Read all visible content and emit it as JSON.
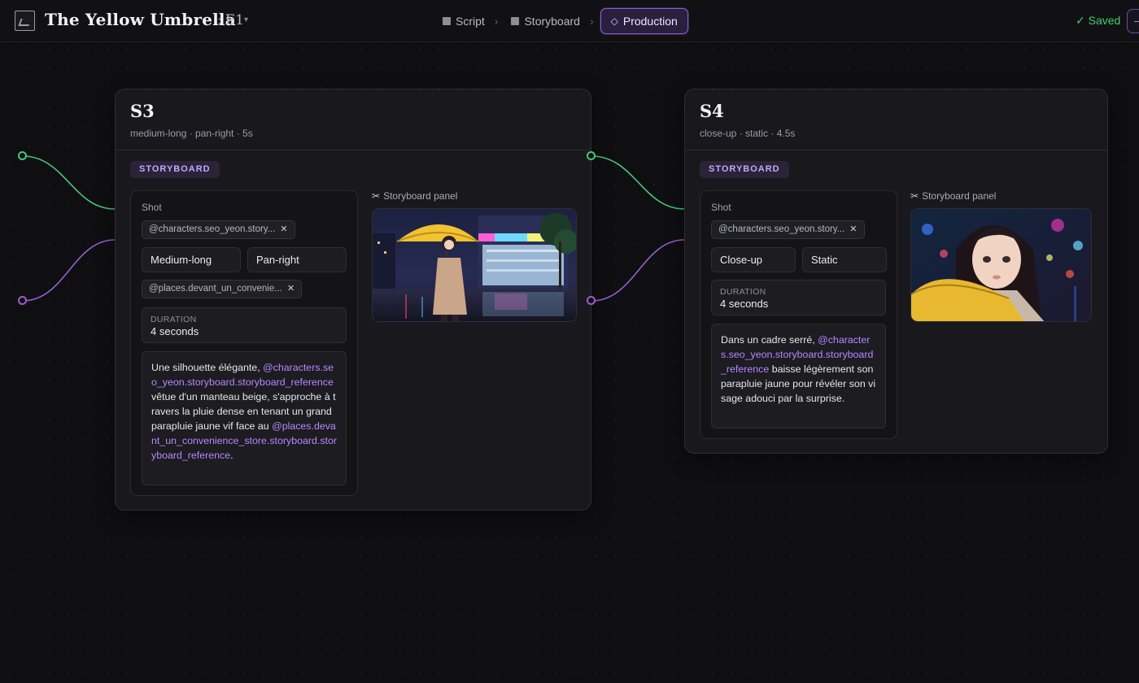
{
  "app": {
    "title": "The Yellow Umbrella",
    "episode_sep": ":",
    "episode": "E1",
    "saved": "✓ Saved"
  },
  "nav": {
    "items": [
      {
        "label": "Script",
        "icon": "square-icon"
      },
      {
        "label": "Storyboard",
        "icon": "square-icon"
      },
      {
        "label": "Production",
        "icon": "diamond-icon",
        "active": true
      }
    ],
    "separator": "›",
    "active_diamond": "◇"
  },
  "nodes": [
    {
      "title": "S3",
      "subtitle": "medium-long · pan-right · 5s",
      "badge": "STORYBOARD",
      "shot_label": "Shot",
      "character_chip": "@characters.seo_yeon.story...",
      "framing": "Medium-long",
      "movement": "Pan-right",
      "place_chip": "@places.devant_un_convenie...",
      "duration_label": "DURATION",
      "duration_value": "4 seconds",
      "desc_1": "Une silhouette élégante, ",
      "desc_ref_1": "@characters.seo_yeon.storyboard.storyboard_reference",
      "desc_2": " vêtue d'un manteau beige, s'approche à travers la pluie dense en tenant un grand parapluie jaune vif face au ",
      "desc_ref_2": "@places.devant_un_convenience_store.storyboard.storyboard_reference",
      "desc_3": ".",
      "panel_label": "Storyboard panel"
    },
    {
      "title": "S4",
      "subtitle": "close-up · static · 4.5s",
      "badge": "STORYBOARD",
      "shot_label": "Shot",
      "character_chip": "@characters.seo_yeon.story...",
      "framing": "Close-up",
      "movement": "Static",
      "duration_label": "DURATION",
      "duration_value": "4 seconds",
      "desc_1": "Dans un cadre serré, ",
      "desc_ref_1": "@characters.seo_yeon.storyboard.storyboard_reference",
      "desc_2": " baisse légèrement son parapluie jaune pour révéler son visage adouci par la surprise.",
      "panel_label": "Storyboard panel"
    }
  ],
  "colors": {
    "accent": "#9b5cd6",
    "green": "#46c77a",
    "saved": "#3fcf72",
    "reference": "#b887ff"
  },
  "icons": {
    "close": "✕",
    "scissors": "✂"
  }
}
